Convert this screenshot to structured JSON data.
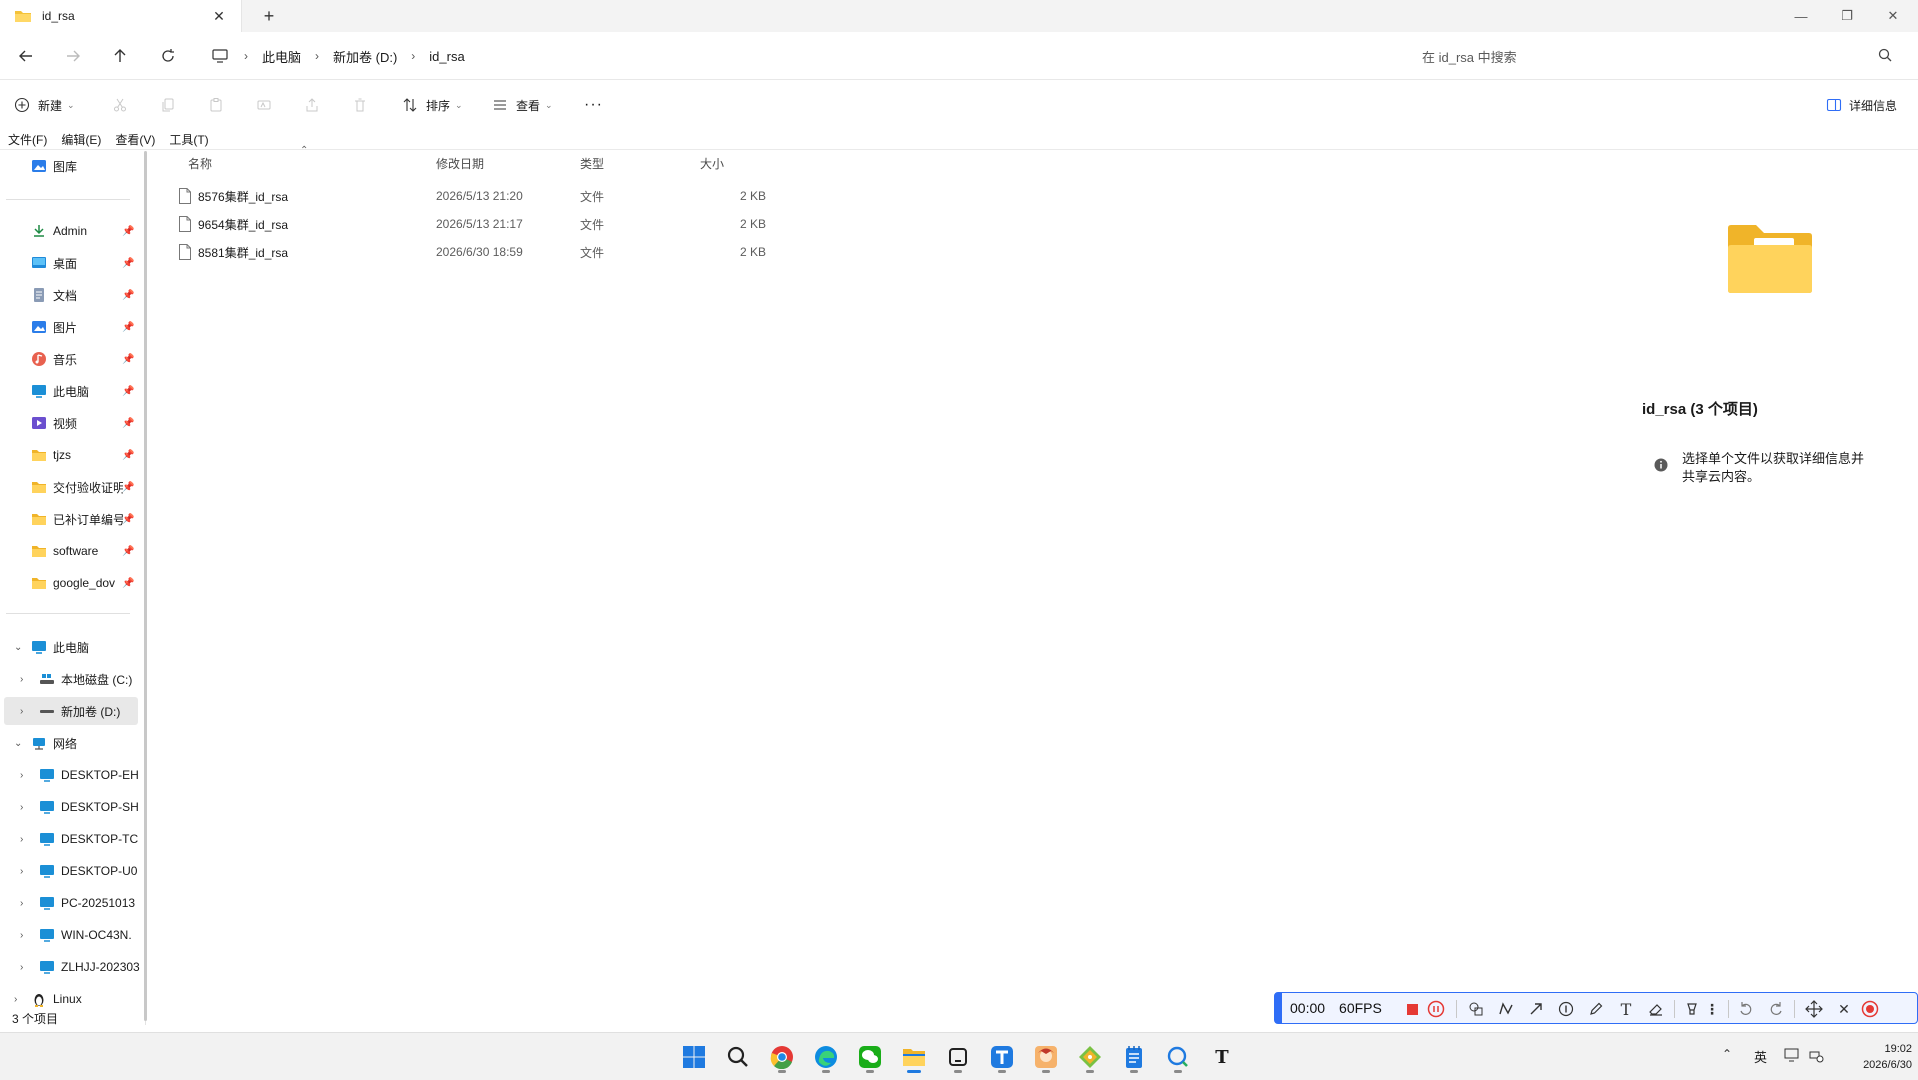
{
  "tab": {
    "title": "id_rsa",
    "close": "✕",
    "new_tab": "+"
  },
  "window": {
    "minimize": "—",
    "restore": "❐",
    "close": "✕"
  },
  "address": {
    "crumbs": [
      "此电脑",
      "新加卷 (D:)",
      "id_rsa"
    ],
    "search_placeholder": "在 id_rsa 中搜索"
  },
  "commands": {
    "new": "新建",
    "sort": "排序",
    "view": "查看",
    "more": "···",
    "details": "详细信息"
  },
  "menu": [
    "文件(F)",
    "编辑(E)",
    "查看(V)",
    "工具(T)"
  ],
  "sidebar": {
    "gallery": "图库",
    "quick": [
      {
        "label": "Admin",
        "icon": "download-icon"
      },
      {
        "label": "桌面",
        "icon": "desktop-icon"
      },
      {
        "label": "文档",
        "icon": "documents-icon"
      },
      {
        "label": "图片",
        "icon": "pictures-icon"
      },
      {
        "label": "音乐",
        "icon": "music-icon"
      },
      {
        "label": "此电脑",
        "icon": "computer-icon"
      },
      {
        "label": "视频",
        "icon": "videos-icon"
      },
      {
        "label": "tjzs",
        "icon": "folder-icon"
      },
      {
        "label": "交付验收证明",
        "icon": "folder-icon"
      },
      {
        "label": "已补订单编号",
        "icon": "folder-icon"
      },
      {
        "label": "software",
        "icon": "folder-icon"
      },
      {
        "label": "google_dov",
        "icon": "folder-icon"
      }
    ],
    "this_pc": "此电脑",
    "drive_c": "本地磁盘 (C:)",
    "drive_d": "新加卷 (D:)",
    "network": "网络",
    "network_items": [
      "DESKTOP-EH",
      "DESKTOP-SH",
      "DESKTOP-TC",
      "DESKTOP-U0",
      "PC-20251013",
      "WIN-OC43N.",
      "ZLHJJ-202303"
    ],
    "linux": "Linux"
  },
  "files": {
    "columns": {
      "name": "名称",
      "modified": "修改日期",
      "type": "类型",
      "size": "大小"
    },
    "rows": [
      {
        "name": "8576集群_id_rsa",
        "modified": "2026/5/13 21:20",
        "type": "文件",
        "size": "2 KB"
      },
      {
        "name": "9654集群_id_rsa",
        "modified": "2026/5/13 21:17",
        "type": "文件",
        "size": "2 KB"
      },
      {
        "name": "8581集群_id_rsa",
        "modified": "2026/6/30 18:59",
        "type": "文件",
        "size": "2 KB"
      }
    ]
  },
  "details": {
    "title": "id_rsa (3 个项目)",
    "info_line1": "选择单个文件以获取详细信息并",
    "info_line2": "共享云内容。"
  },
  "status": "3 个项目",
  "recorder": {
    "time": "00:00",
    "fps": "60FPS"
  },
  "clock": {
    "time": "19:02",
    "date": "2026/6/30"
  },
  "tray": {
    "ime": "英"
  },
  "colors": {
    "accent": "#2f6df6",
    "folder": "#f4c23a",
    "selection": "#e8e8e8"
  }
}
